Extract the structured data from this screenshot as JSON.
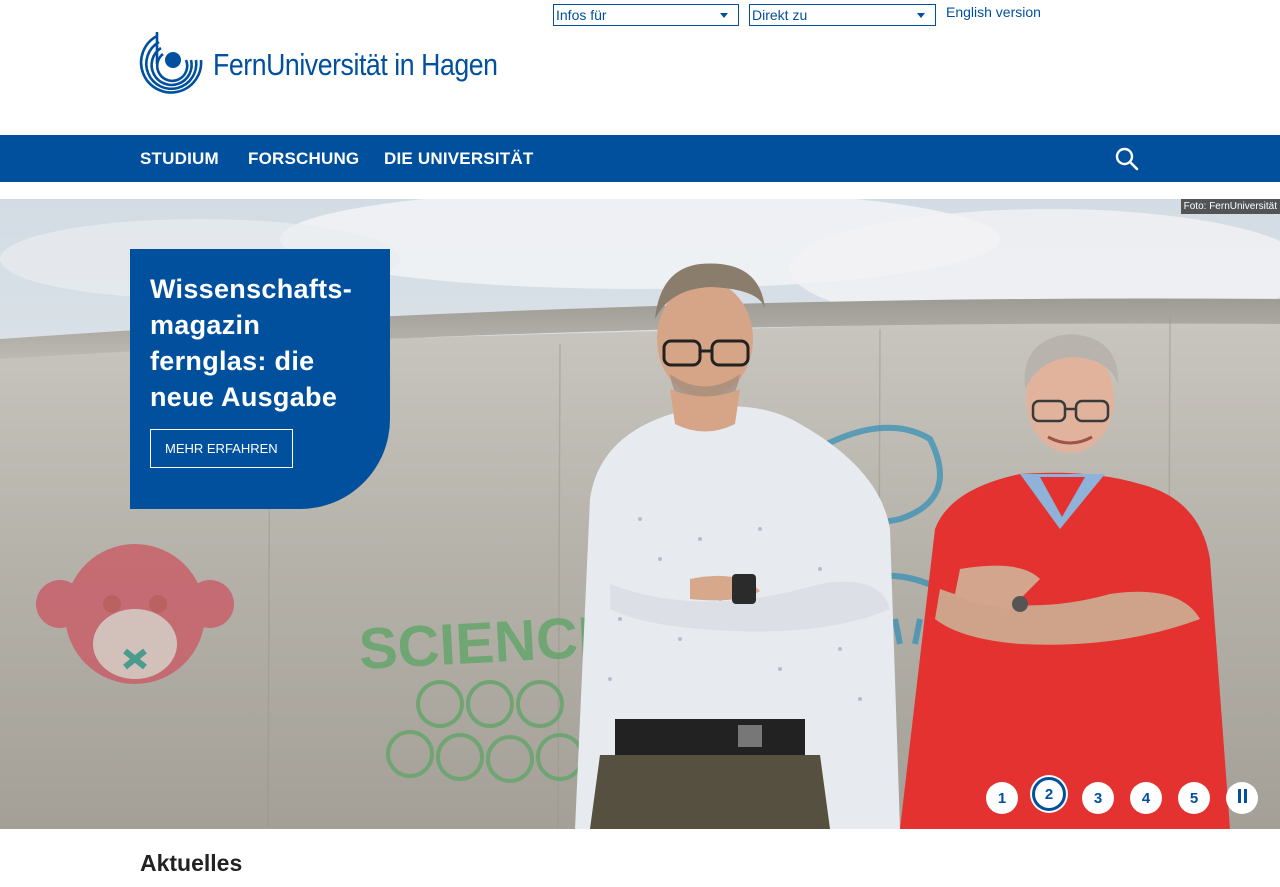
{
  "header": {
    "logo_text": "FernUniversität in Hagen",
    "infos_select": "Infos für",
    "direkt_select": "Direkt zu",
    "english_link": "English version"
  },
  "nav": {
    "studium": "STUDIUM",
    "forschung": "FORSCHUNG",
    "universitaet": "DIE UNIVERSITÄT",
    "search_icon": "search-icon"
  },
  "hero": {
    "credit": "Foto: FernUniversität",
    "title": "Wissenschafts-magazin fernglas: die neue Ausgabe",
    "button": "MEHR ERFAHREN",
    "wall_graffiti": "SCIENCE",
    "slides": [
      "1",
      "2",
      "3",
      "4",
      "5"
    ],
    "active_slide": "2",
    "pause_icon": "pause-icon"
  },
  "sections": {
    "news_title": "Aktuelles"
  },
  "colors": {
    "brand_blue": "#00509e",
    "wall": "#b9b6ae",
    "sky": "#dfe4e9",
    "red_shirt": "#e3322f"
  }
}
